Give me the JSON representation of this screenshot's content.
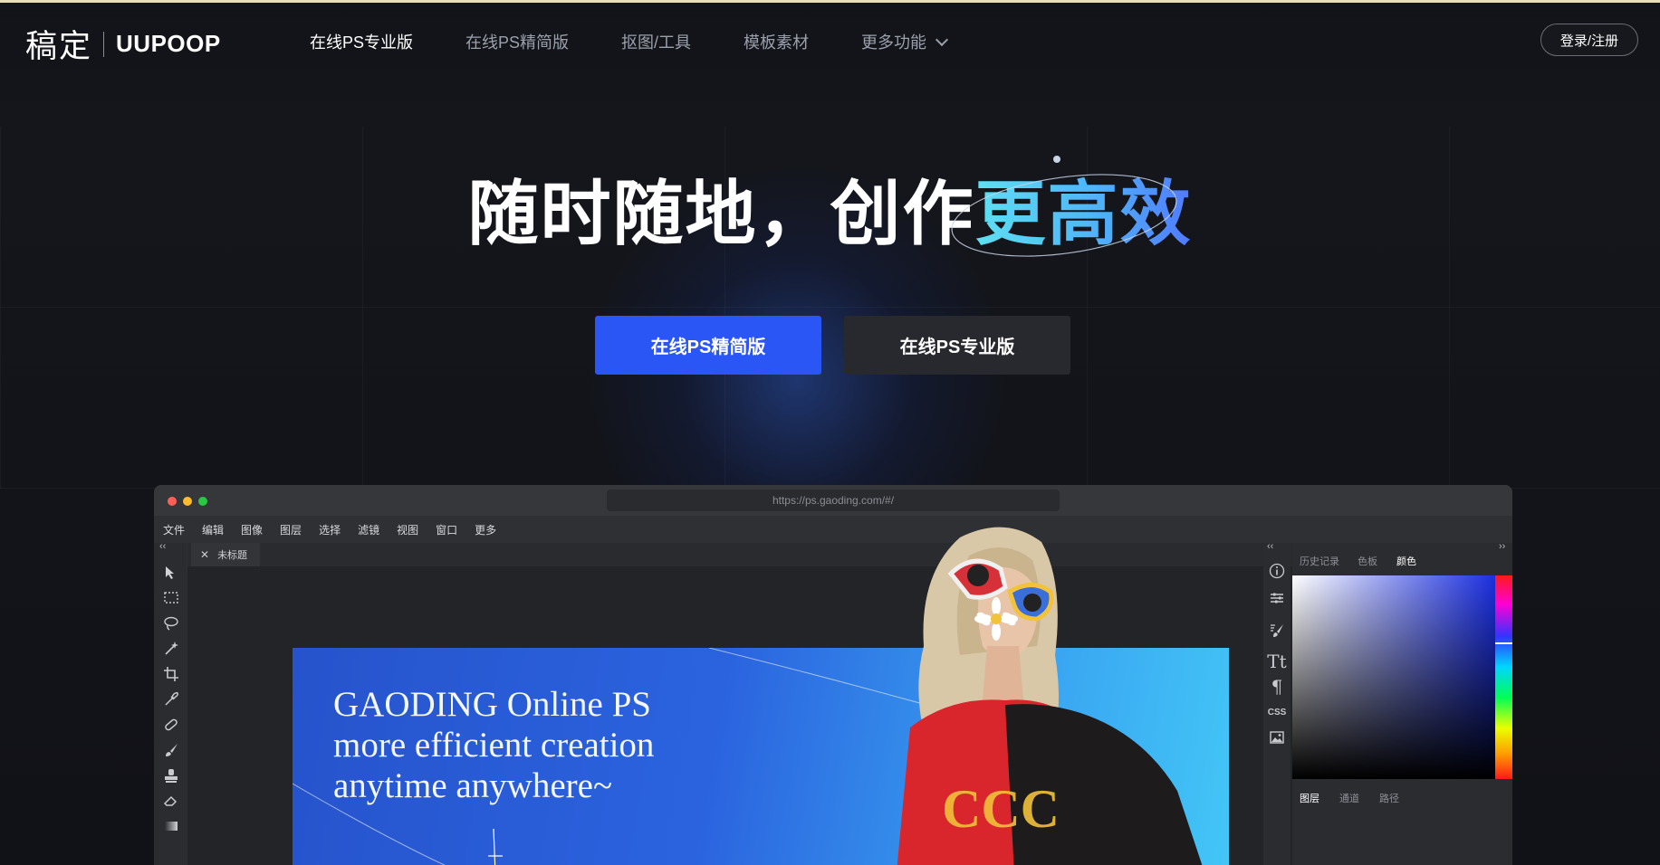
{
  "header": {
    "logo_cn": "稿定",
    "logo_en": "UUPOOP",
    "nav": [
      {
        "label": "在线PS专业版",
        "active": true
      },
      {
        "label": "在线PS精简版",
        "active": false
      },
      {
        "label": "抠图/工具",
        "active": false
      },
      {
        "label": "模板素材",
        "active": false
      },
      {
        "label": "更多功能",
        "active": false,
        "has_dropdown": true
      }
    ],
    "login_label": "登录/注册"
  },
  "hero": {
    "title_main": "随时随地，创作",
    "title_highlight": "更高效",
    "primary_button": "在线PS精简版",
    "secondary_button": "在线PS专业版"
  },
  "editor": {
    "url": "https://ps.gaoding.com/#/",
    "menu": [
      "文件",
      "编辑",
      "图像",
      "图层",
      "选择",
      "滤镜",
      "视图",
      "窗口",
      "更多"
    ],
    "doc_tab": "未标题",
    "artboard_text": [
      "GAODING Online PS",
      "more efficient creation",
      "anytime anywhere~"
    ],
    "panel_tabs_top": [
      "历史记录",
      "色板",
      "颜色"
    ],
    "panel_tabs_top_active": "颜色",
    "panel_tabs_bottom": [
      "图层",
      "通道",
      "路径"
    ],
    "panel_tabs_bottom_active": "图层",
    "tools": [
      "move-tool",
      "marquee-tool",
      "lasso-tool",
      "magic-wand-tool",
      "crop-tool",
      "eyedropper-tool",
      "healing-tool",
      "brush-tool",
      "stamp-tool",
      "eraser-tool",
      "gradient-tool"
    ],
    "panel_icons": [
      "info",
      "adjustments",
      "brush-settings",
      "text",
      "paragraph",
      "css",
      "image"
    ],
    "css_icon_label": "CSS"
  },
  "colors": {
    "accent": "#2b56f6",
    "highlight_gradient_start": "#5ee0f2",
    "highlight_gradient_end": "#5079ff",
    "background": "#111217"
  }
}
